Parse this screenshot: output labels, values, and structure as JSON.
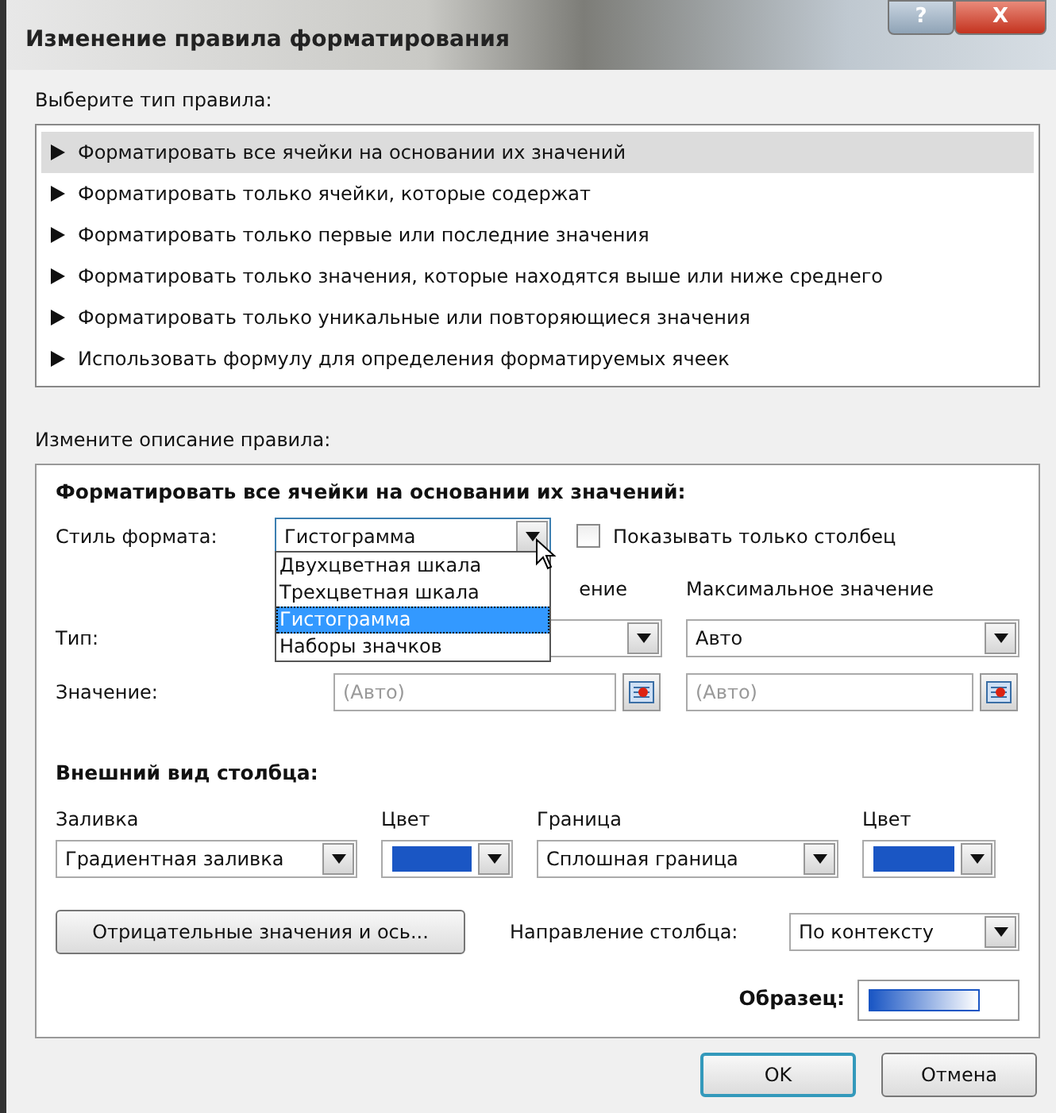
{
  "window": {
    "title": "Изменение правила форматирования"
  },
  "title_buttons": [
    {
      "kind": "help",
      "label": "?"
    },
    {
      "kind": "close",
      "label": "X"
    }
  ],
  "rule_type": {
    "label": "Выберите тип правила:",
    "items": [
      {
        "text": "Форматировать все ячейки на основании их значений",
        "selected": true
      },
      {
        "text": "Форматировать только ячейки, которые содержат",
        "selected": false
      },
      {
        "text": "Форматировать только первые или последние значения",
        "selected": false
      },
      {
        "text": "Форматировать только значения, которые находятся выше или ниже среднего",
        "selected": false
      },
      {
        "text": "Форматировать только уникальные или повторяющиеся значения",
        "selected": false
      },
      {
        "text": "Использовать формулу для определения форматируемых ячеек",
        "selected": false
      }
    ]
  },
  "description": {
    "label": "Измените описание правила:",
    "heading": "Форматировать все ячейки на основании их значений:",
    "format_style": {
      "label": "Стиль формата:",
      "value": "Гистограмма",
      "expanded": true,
      "options": [
        {
          "text": "Двухцветная шкала",
          "selected": false
        },
        {
          "text": "Трехцветная шкала",
          "selected": false
        },
        {
          "text": "Гистограмма",
          "selected": true
        },
        {
          "text": "Наборы значков",
          "selected": false
        }
      ]
    },
    "show_bar_only": {
      "label": "Показывать только столбец",
      "checked": false
    },
    "min_header": "ение",
    "max_header": "Максимальное значение",
    "type_label": "Тип:",
    "max_type": "Авто",
    "value_label": "Значение:",
    "min_value": "(Авто)",
    "max_value": "(Авто)"
  },
  "appearance": {
    "heading": "Внешний вид столбца:",
    "fill_label": "Заливка",
    "fill_value": "Градиентная заливка",
    "border_label": "Граница",
    "border_value": "Сплошная граница",
    "color_pickers": [
      {
        "label": "Цвет",
        "color": "#1a56c4"
      },
      {
        "label": "Цвет",
        "color": "#1a56c4"
      }
    ],
    "negative_button": "Отрицательные значения и ось...",
    "direction_label": "Направление столбца:",
    "direction_value": "По контексту",
    "preview_label": "Образец:"
  },
  "buttons": [
    {
      "label": "OK",
      "default": true
    },
    {
      "label": "Отмена",
      "default": false
    }
  ]
}
